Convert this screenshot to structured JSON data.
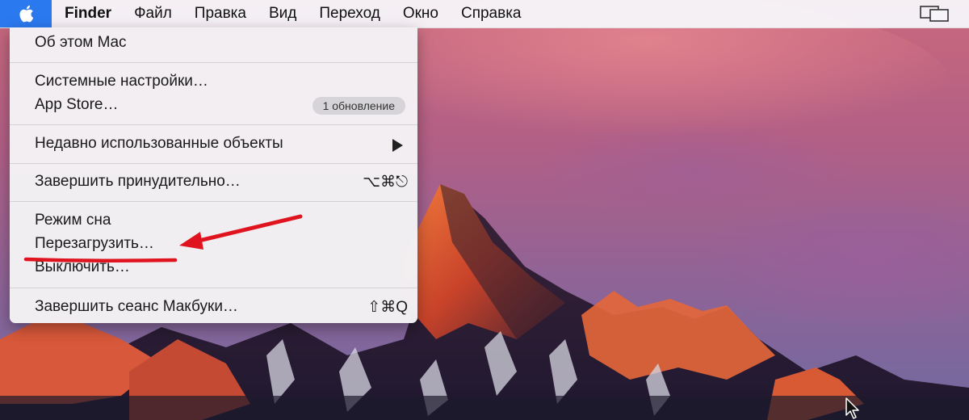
{
  "menubar": {
    "app_name": "Finder",
    "items": [
      "Файл",
      "Правка",
      "Вид",
      "Переход",
      "Окно",
      "Справка"
    ]
  },
  "apple_menu": {
    "about": "Об этом Mac",
    "system_prefs": "Системные настройки…",
    "app_store": "App Store…",
    "app_store_badge": "1 обновление",
    "recent_items": "Недавно использованные объекты",
    "force_quit": "Завершить принудительно…",
    "force_quit_shortcut": "⌥⌘⎋",
    "sleep": "Режим сна",
    "restart": "Перезагрузить…",
    "shutdown": "Выключить…",
    "logout": "Завершить сеанс Макбуки…",
    "logout_shortcut": "⇧⌘Q"
  },
  "colors": {
    "apple_highlight": "#2b79ef",
    "annotation": "#e0141e"
  },
  "icons": {
    "apple": "apple-logo-icon",
    "display_status": "display-mirroring-icon",
    "cursor": "mouse-pointer-icon"
  }
}
